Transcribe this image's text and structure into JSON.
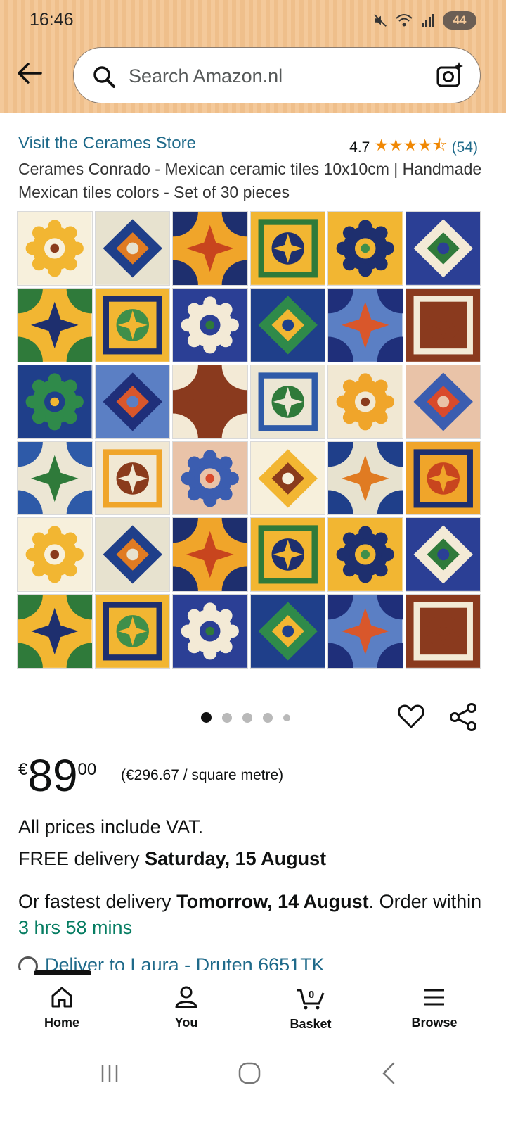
{
  "status_bar": {
    "time": "16:46",
    "battery": "44"
  },
  "search": {
    "placeholder": "Search Amazon.nl"
  },
  "product": {
    "store_link": "Visit the Cerames Store",
    "rating": "4.7",
    "stars": "★★★★⯪",
    "rating_count": "(54)",
    "title": "Cerames Conrado - Mexican ceramic tiles 10x10cm | Handmade Mexican tiles colors - Set of 30 pieces"
  },
  "carousel": {
    "dot_count": 5,
    "active_index": 0
  },
  "price": {
    "currency": "€",
    "whole": "89",
    "fraction": "00",
    "unit_price": "(€296.67 / square metre)"
  },
  "vat_notice": "All prices include VAT.",
  "delivery": {
    "free_prefix": "FREE delivery ",
    "free_date": "Saturday, 15 August",
    "fast_prefix": "Or fastest delivery ",
    "fast_date": "Tomorrow, 14 August",
    "order_within": ". Order within ",
    "countdown": "3 hrs 58 mins",
    "deliver_to": "Deliver to Laura - Druten 6651TK"
  },
  "bottom_nav": {
    "items": [
      {
        "label": "Home",
        "icon": "home-icon"
      },
      {
        "label": "You",
        "icon": "user-icon"
      },
      {
        "label": "Basket",
        "icon": "basket-icon",
        "badge": "0"
      },
      {
        "label": "Browse",
        "icon": "menu-icon"
      }
    ]
  },
  "colors": {
    "header_bg": "#f4c99a",
    "link": "#1f6a8a",
    "star": "#f08804",
    "countdown": "#067d62"
  }
}
